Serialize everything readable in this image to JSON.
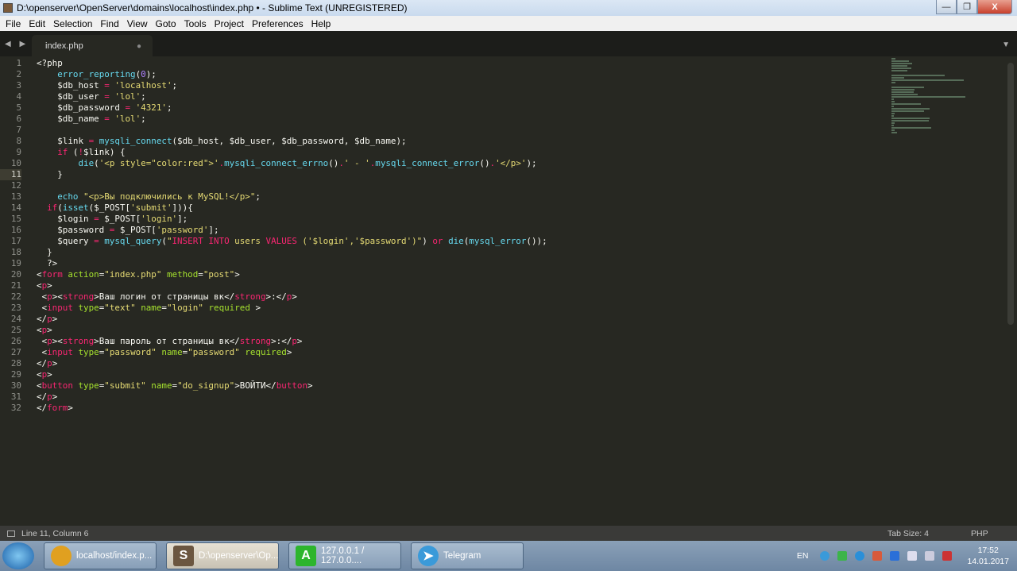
{
  "window": {
    "title": "D:\\openserver\\OpenServer\\domains\\localhost\\index.php • - Sublime Text (UNREGISTERED)",
    "minimize": "—",
    "restore": "❐",
    "close": "X"
  },
  "menu": [
    "File",
    "Edit",
    "Selection",
    "Find",
    "View",
    "Goto",
    "Tools",
    "Project",
    "Preferences",
    "Help"
  ],
  "tab": {
    "nav": "◀ ▶",
    "label": "index.php",
    "modified": "●",
    "menu_arrow": "▼"
  },
  "editor": {
    "current_line": 11,
    "lines": [
      [
        [
          "d",
          "<?php"
        ]
      ],
      [
        [
          "d",
          "    "
        ],
        [
          "f",
          "error_reporting"
        ],
        [
          "d",
          "("
        ],
        [
          "n",
          "0"
        ],
        [
          "d",
          ");"
        ]
      ],
      [
        [
          "d",
          "    $db_host "
        ],
        [
          "k",
          "="
        ],
        [
          "d",
          " "
        ],
        [
          "s",
          "'localhost'"
        ],
        [
          "d",
          ";"
        ]
      ],
      [
        [
          "d",
          "    $db_user "
        ],
        [
          "k",
          "="
        ],
        [
          "d",
          " "
        ],
        [
          "s",
          "'lol'"
        ],
        [
          "d",
          ";"
        ]
      ],
      [
        [
          "d",
          "    $db_password "
        ],
        [
          "k",
          "="
        ],
        [
          "d",
          " "
        ],
        [
          "s",
          "'4321'"
        ],
        [
          "d",
          ";"
        ]
      ],
      [
        [
          "d",
          "    $db_name "
        ],
        [
          "k",
          "="
        ],
        [
          "d",
          " "
        ],
        [
          "s",
          "'lol'"
        ],
        [
          "d",
          ";"
        ]
      ],
      [
        [
          "d",
          ""
        ]
      ],
      [
        [
          "d",
          "    $link "
        ],
        [
          "k",
          "="
        ],
        [
          "d",
          " "
        ],
        [
          "f",
          "mysqli_connect"
        ],
        [
          "d",
          "($db_host, $db_user, $db_password, $db_name);"
        ]
      ],
      [
        [
          "d",
          "    "
        ],
        [
          "k",
          "if"
        ],
        [
          "d",
          " ("
        ],
        [
          "k",
          "!"
        ],
        [
          "d",
          "$link) {"
        ]
      ],
      [
        [
          "d",
          "        "
        ],
        [
          "f",
          "die"
        ],
        [
          "d",
          "("
        ],
        [
          "s",
          "'<p style=\"color:red\">'"
        ],
        [
          "k",
          "."
        ],
        [
          "f",
          "mysqli_connect_errno"
        ],
        [
          "d",
          "()"
        ],
        [
          "k",
          "."
        ],
        [
          "s",
          "' - '"
        ],
        [
          "k",
          "."
        ],
        [
          "f",
          "mysqli_connect_error"
        ],
        [
          "d",
          "()"
        ],
        [
          "k",
          "."
        ],
        [
          "s",
          "'</p>'"
        ],
        [
          "d",
          ");"
        ]
      ],
      [
        [
          "d",
          "    }"
        ]
      ],
      [
        [
          "d",
          ""
        ]
      ],
      [
        [
          "d",
          "    "
        ],
        [
          "f",
          "echo"
        ],
        [
          "d",
          " "
        ],
        [
          "s",
          "\"<p>Вы подключились к MySQL!</p>\""
        ],
        [
          "d",
          ";"
        ]
      ],
      [
        [
          "d",
          "  "
        ],
        [
          "k",
          "if"
        ],
        [
          "d",
          "("
        ],
        [
          "f",
          "isset"
        ],
        [
          "d",
          "($_POST["
        ],
        [
          "s",
          "'submit'"
        ],
        [
          "d",
          "])){"
        ]
      ],
      [
        [
          "d",
          "    $login "
        ],
        [
          "k",
          "="
        ],
        [
          "d",
          " $_POST["
        ],
        [
          "s",
          "'login'"
        ],
        [
          "d",
          "];"
        ]
      ],
      [
        [
          "d",
          "    $password "
        ],
        [
          "k",
          "="
        ],
        [
          "d",
          " $_POST["
        ],
        [
          "s",
          "'password'"
        ],
        [
          "d",
          "];"
        ]
      ],
      [
        [
          "d",
          "    $query "
        ],
        [
          "k",
          "="
        ],
        [
          "d",
          " "
        ],
        [
          "f",
          "mysql_query"
        ],
        [
          "d",
          "("
        ],
        [
          "s",
          "\""
        ],
        [
          "k",
          "INSERT INTO"
        ],
        [
          "s",
          " users "
        ],
        [
          "k",
          "VALUES"
        ],
        [
          "s",
          " ('$login','$password')\""
        ],
        [
          "d",
          ") "
        ],
        [
          "k",
          "or"
        ],
        [
          "d",
          " "
        ],
        [
          "f",
          "die"
        ],
        [
          "d",
          "("
        ],
        [
          "f",
          "mysql_error"
        ],
        [
          "d",
          "());"
        ]
      ],
      [
        [
          "d",
          "  }"
        ]
      ],
      [
        [
          "d",
          "  ?>"
        ]
      ],
      [
        [
          "d",
          "<"
        ],
        [
          "k",
          "form"
        ],
        [
          "d",
          " "
        ],
        [
          "a",
          "action"
        ],
        [
          "d",
          "="
        ],
        [
          "s",
          "\"index.php\""
        ],
        [
          "d",
          " "
        ],
        [
          "a",
          "method"
        ],
        [
          "d",
          "="
        ],
        [
          "s",
          "\"post\""
        ],
        [
          "d",
          ">"
        ]
      ],
      [
        [
          "d",
          "<"
        ],
        [
          "k",
          "p"
        ],
        [
          "d",
          ">"
        ]
      ],
      [
        [
          "d",
          " <"
        ],
        [
          "k",
          "p"
        ],
        [
          "d",
          "><"
        ],
        [
          "k",
          "strong"
        ],
        [
          "d",
          ">Ваш логин от страницы вк</"
        ],
        [
          "k",
          "strong"
        ],
        [
          "d",
          ">:</"
        ],
        [
          "k",
          "p"
        ],
        [
          "d",
          ">"
        ]
      ],
      [
        [
          "d",
          " <"
        ],
        [
          "k",
          "input"
        ],
        [
          "d",
          " "
        ],
        [
          "a",
          "type"
        ],
        [
          "d",
          "="
        ],
        [
          "s",
          "\"text\""
        ],
        [
          "d",
          " "
        ],
        [
          "a",
          "name"
        ],
        [
          "d",
          "="
        ],
        [
          "s",
          "\"login\""
        ],
        [
          "d",
          " "
        ],
        [
          "a",
          "required"
        ],
        [
          "d",
          " >"
        ]
      ],
      [
        [
          "d",
          "</"
        ],
        [
          "k",
          "p"
        ],
        [
          "d",
          ">"
        ]
      ],
      [
        [
          "d",
          "<"
        ],
        [
          "k",
          "p"
        ],
        [
          "d",
          ">"
        ]
      ],
      [
        [
          "d",
          " <"
        ],
        [
          "k",
          "p"
        ],
        [
          "d",
          "><"
        ],
        [
          "k",
          "strong"
        ],
        [
          "d",
          ">Ваш пароль от страницы вк</"
        ],
        [
          "k",
          "strong"
        ],
        [
          "d",
          ">:</"
        ],
        [
          "k",
          "p"
        ],
        [
          "d",
          ">"
        ]
      ],
      [
        [
          "d",
          " <"
        ],
        [
          "k",
          "input"
        ],
        [
          "d",
          " "
        ],
        [
          "a",
          "type"
        ],
        [
          "d",
          "="
        ],
        [
          "s",
          "\"password\""
        ],
        [
          "d",
          " "
        ],
        [
          "a",
          "name"
        ],
        [
          "d",
          "="
        ],
        [
          "s",
          "\"password\""
        ],
        [
          "d",
          " "
        ],
        [
          "a",
          "required"
        ],
        [
          "d",
          ">"
        ]
      ],
      [
        [
          "d",
          "</"
        ],
        [
          "k",
          "p"
        ],
        [
          "d",
          ">"
        ]
      ],
      [
        [
          "d",
          "<"
        ],
        [
          "k",
          "p"
        ],
        [
          "d",
          ">"
        ]
      ],
      [
        [
          "d",
          "<"
        ],
        [
          "k",
          "button"
        ],
        [
          "d",
          " "
        ],
        [
          "a",
          "type"
        ],
        [
          "d",
          "="
        ],
        [
          "s",
          "\"submit\""
        ],
        [
          "d",
          " "
        ],
        [
          "a",
          "name"
        ],
        [
          "d",
          "="
        ],
        [
          "s",
          "\"do_signup\""
        ],
        [
          "d",
          ">ВОЙТИ</"
        ],
        [
          "k",
          "button"
        ],
        [
          "d",
          ">"
        ]
      ],
      [
        [
          "d",
          "</"
        ],
        [
          "k",
          "p"
        ],
        [
          "d",
          ">"
        ]
      ],
      [
        [
          "d",
          "</"
        ],
        [
          "k",
          "form"
        ],
        [
          "d",
          ">"
        ]
      ]
    ]
  },
  "status": {
    "position": "Line 11, Column 6",
    "tab_size": "Tab Size: 4",
    "syntax": "PHP"
  },
  "taskbar": {
    "items": [
      {
        "label": "localhost/index.p...",
        "icon": "chrome-icon",
        "color": "#e0a020",
        "glyph": ""
      },
      {
        "label": "D:\\openserver\\Op...",
        "icon": "sublime-icon",
        "color": "#6b5640",
        "glyph": "S"
      },
      {
        "label": "127.0.0.1 / 127.0.0....",
        "icon": "adminer-icon",
        "color": "#2db52d",
        "glyph": "A"
      },
      {
        "label": "Telegram",
        "icon": "telegram-icon",
        "color": "#3a9ad9",
        "glyph": "➤"
      }
    ],
    "lang": "EN",
    "time": "17:52",
    "date": "14.01.2017"
  }
}
